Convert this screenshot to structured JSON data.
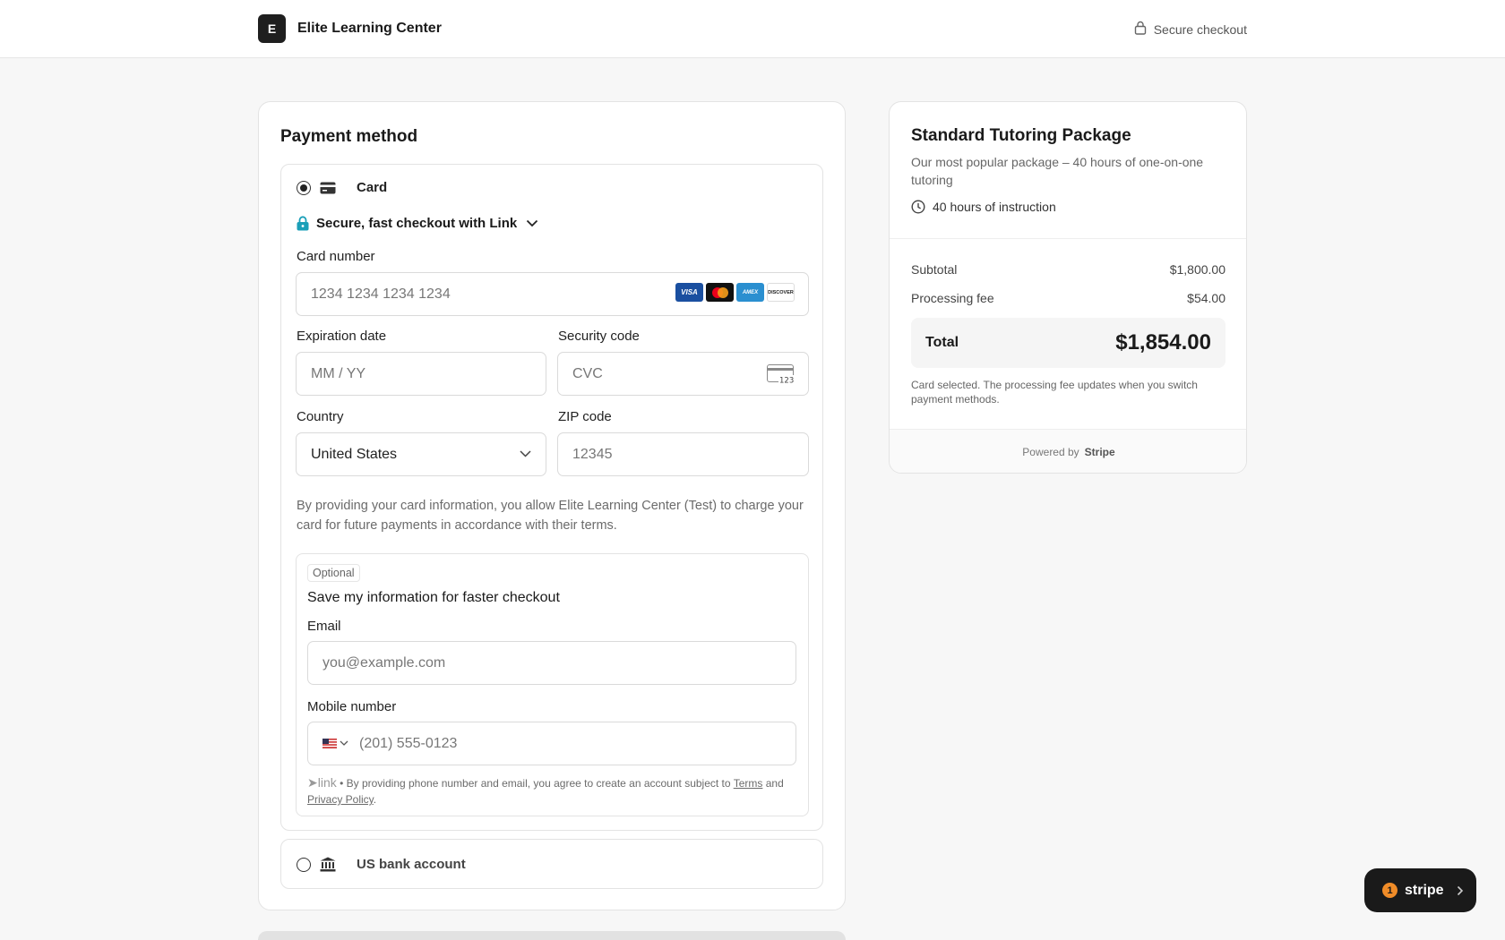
{
  "header": {
    "logo_letter": "E",
    "brand_name": "Elite Learning Center",
    "secure_label": "Secure checkout"
  },
  "payment": {
    "title": "Payment method",
    "card_option_label": "Card",
    "link_label": "Secure, fast checkout with Link",
    "card_number_label": "Card number",
    "card_number_placeholder": "1234 1234 1234 1234",
    "card_brands": [
      "VISA",
      "MC",
      "AMEX",
      "DISCOVER"
    ],
    "expiration_label": "Expiration date",
    "expiration_placeholder": "MM / YY",
    "security_label": "Security code",
    "security_placeholder": "CVC",
    "cvc_icon_text": "123",
    "country_label": "Country",
    "country_value": "United States",
    "zip_label": "ZIP code",
    "zip_placeholder": "12345",
    "terms_text": "By providing your card information, you allow Elite Learning Center (Test) to charge your card for future payments in accordance with their terms.",
    "save": {
      "optional_badge": "Optional",
      "title": "Save my information for faster checkout",
      "email_label": "Email",
      "email_placeholder": "you@example.com",
      "mobile_label": "Mobile number",
      "mobile_placeholder": "(201) 555-0123",
      "link_word": "link",
      "fine_print": "• By providing phone number and email, you agree to create an account subject to",
      "terms_link": "Terms",
      "and_word": "and",
      "privacy_link": "Privacy Policy",
      "period": "."
    },
    "bank_option_label": "US bank account"
  },
  "summary": {
    "title": "Standard Tutoring Package",
    "description": "Our most popular package – 40 hours of one-on-one tutoring",
    "hours": "40 hours of instruction",
    "subtotal_label": "Subtotal",
    "subtotal_value": "$1,800.00",
    "fee_label": "Processing fee",
    "fee_value": "$54.00",
    "total_label": "Total",
    "total_value": "$1,854.00",
    "note": "Card selected. The processing fee updates when you switch payment methods.",
    "powered_by": "Powered by",
    "powered_brand": "Stripe"
  },
  "stripe_badge": {
    "count": "1",
    "label": "stripe"
  },
  "colors": {
    "link_lock": "#1a9fb8",
    "badge_orange": "#f08c28",
    "visa_blue": "#1a4fa0",
    "amex_blue": "#2a8fd0"
  }
}
